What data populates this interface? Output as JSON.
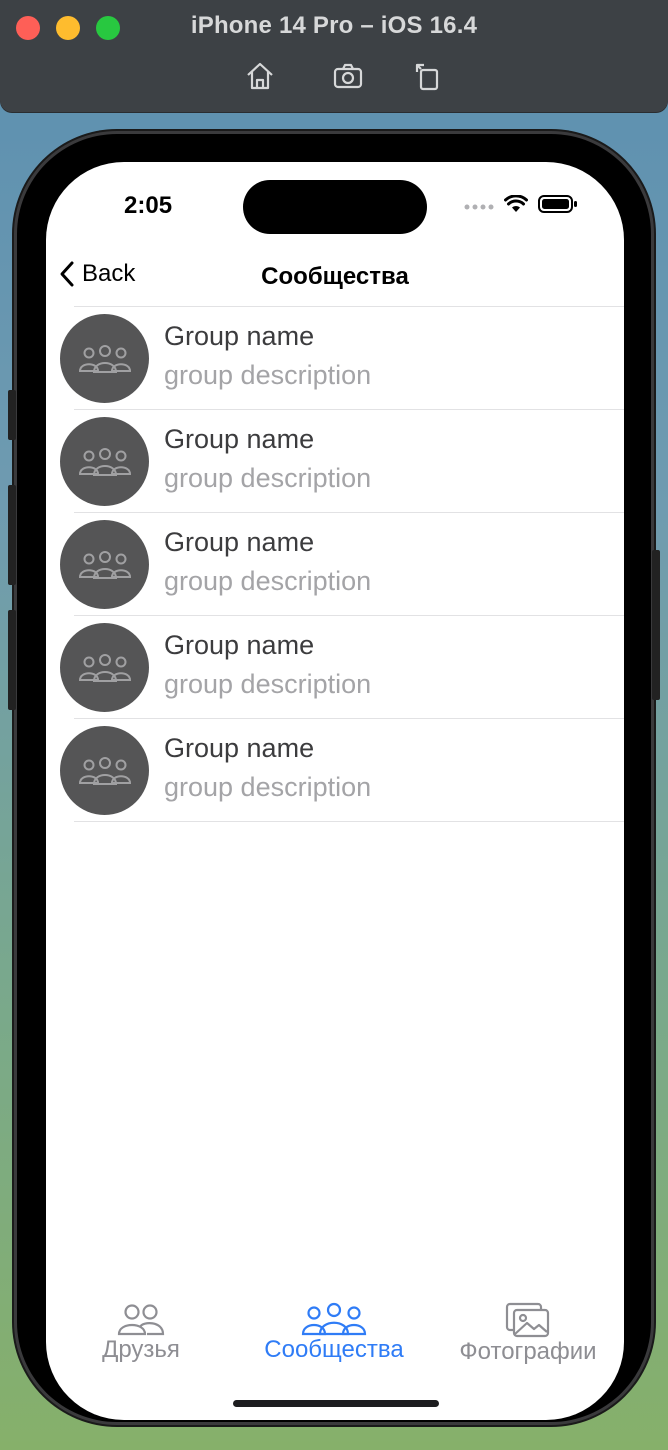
{
  "simulator": {
    "title": "iPhone 14 Pro – iOS 16.4",
    "toolbar": [
      "home-icon",
      "screenshot-icon",
      "rotate-icon"
    ]
  },
  "status_bar": {
    "time": "2:05"
  },
  "navbar": {
    "back_label": "Back",
    "title": "Сообщества"
  },
  "groups": [
    {
      "name": "Group name",
      "description": "group description"
    },
    {
      "name": "Group name",
      "description": "group description"
    },
    {
      "name": "Group name",
      "description": "group description"
    },
    {
      "name": "Group name",
      "description": "group description"
    },
    {
      "name": "Group name",
      "description": "group description"
    }
  ],
  "tabbar": {
    "tabs": [
      {
        "label": "Друзья",
        "icon": "friends-icon",
        "selected": false
      },
      {
        "label": "Сообщества",
        "icon": "communities-icon",
        "selected": true
      },
      {
        "label": "Фотографии",
        "icon": "photos-icon",
        "selected": false
      }
    ]
  },
  "colors": {
    "accent": "#2f7cf6",
    "inactive": "#8e8e93",
    "avatar_bg": "#555556"
  }
}
